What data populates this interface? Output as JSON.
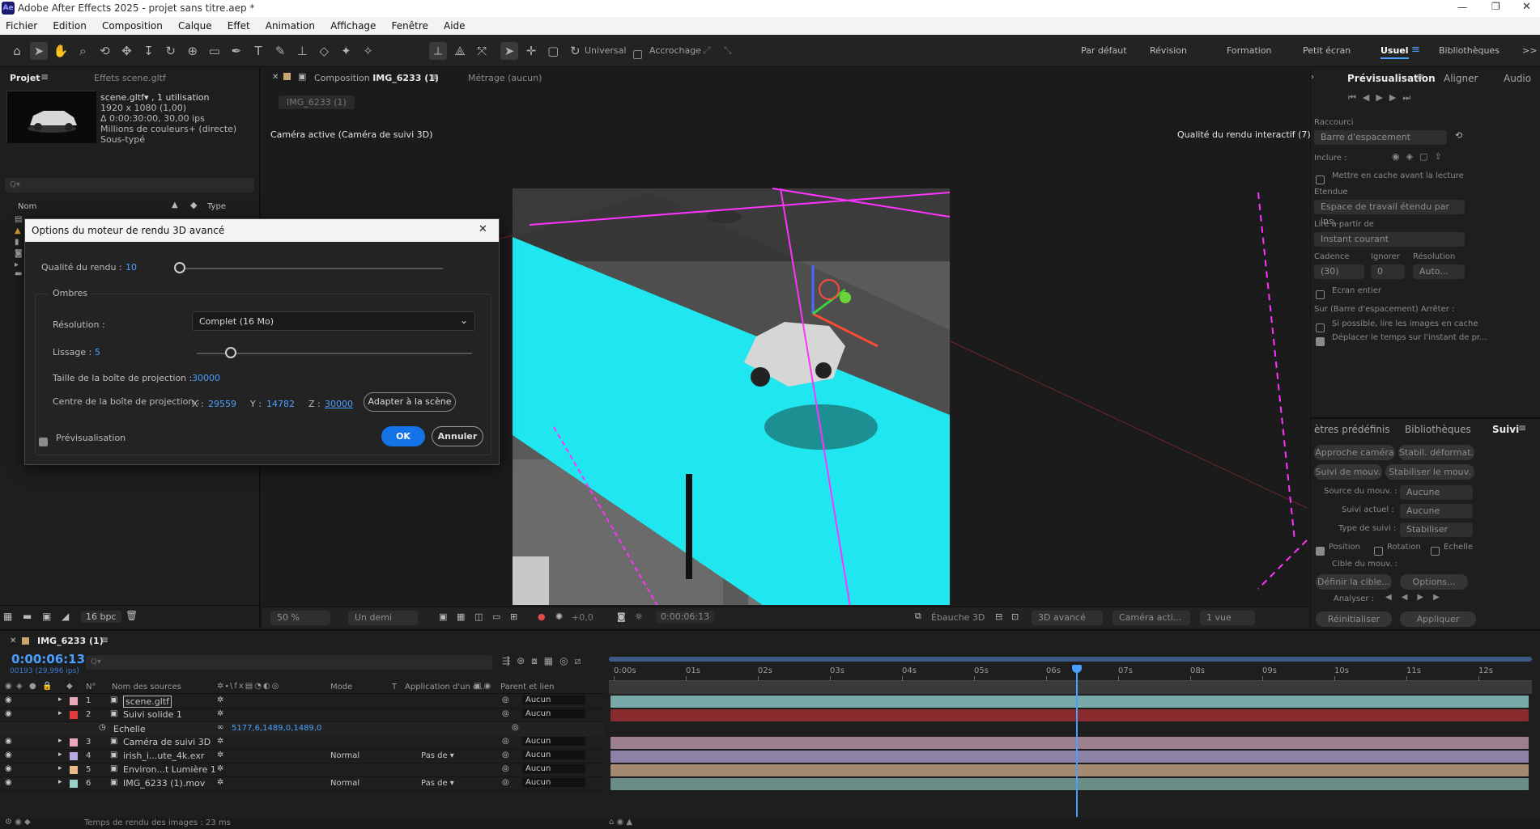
{
  "app": {
    "title": "Adobe After Effects 2025 - projet sans titre.aep *",
    "logo_text": "Ae",
    "accent": "#4aa0ff",
    "brand": "#1a1a6e"
  },
  "menu": [
    "Fichier",
    "Edition",
    "Composition",
    "Calque",
    "Effet",
    "Animation",
    "Affichage",
    "Fenêtre",
    "Aide"
  ],
  "toolbar": {
    "universal": "Universal",
    "snap": "Accrochage",
    "workspaces": [
      "Par défaut",
      "Révision",
      "Formation",
      "Petit écran",
      "Usuel",
      "Bibliothèques"
    ],
    "active_workspace": "Usuel",
    "more": ">>"
  },
  "project": {
    "tab": "Projet",
    "effects_tab": "Effets scene.gltf",
    "file_name": "scene.gltf▾ , 1 utilisation",
    "dims": "1920 x 1080 (1,00)",
    "duration": "Δ 0:00:30:00, 30,00 ips",
    "colors": "Millions de couleurs+ (directe)",
    "sub": "Sous-typé",
    "search_placeholder": "Q▾",
    "col_name": "Nom",
    "col_type": "Type",
    "bpc": "16 bpc"
  },
  "composition": {
    "tab": "Composition",
    "tab_name": "IMG_6233 (1)",
    "footage_tab": "Métrage (aucun)",
    "breadcrumb": "IMG_6233 (1)",
    "camera_label": "Caméra active (Caméra de suivi 3D)",
    "quality_label": "Qualité du rendu interactif (7)",
    "footer": {
      "zoom": "50 %",
      "resolution": "Un demi",
      "exposure": "+0,0",
      "time": "0:00:06:13",
      "draft": "Ébauche 3D",
      "renderer": "3D avancé",
      "camera": "Caméra acti...",
      "views": "1 vue"
    }
  },
  "dialog": {
    "title": "Options du moteur de rendu 3D avancé",
    "quality_label": "Qualité du rendu :",
    "quality_value": "10",
    "shadows_label": "Ombres",
    "resolution_label": "Résolution :",
    "resolution_value": "Complet (16 Mo)",
    "smoothing_label": "Lissage :",
    "smoothing_value": "5",
    "box_size_label": "Taille de la boîte de projection :",
    "box_size_value": "30000",
    "box_center_label": "Centre de la boîte de projection :",
    "x_label": "X :",
    "x_value": "29559",
    "y_label": "Y :",
    "y_value": "14782",
    "z_label": "Z :",
    "z_value": "30000",
    "fit_button": "Adapter à la scène",
    "preview_label": "Prévisualisation",
    "ok": "OK",
    "cancel": "Annuler",
    "close": "✕"
  },
  "preview_panel": {
    "tabs": [
      "Prévisualisation",
      "Aligner",
      "Audio"
    ],
    "shortcut_label": "Raccourci",
    "shortcut_value": "Barre d'espacement",
    "include_label": "Inclure :",
    "cache_label": "Mettre en cache avant la lecture",
    "range_label": "Etendue",
    "range_value": "Espace de travail étendu par ins...",
    "play_from_label": "Lire à partir de",
    "play_from_value": "Instant courant",
    "frame_rate_label": "Cadence",
    "skip_label": "Ignorer",
    "resolution_label": "Résolution",
    "frame_rate_value": "(30)",
    "skip_value": "0",
    "resolution_value": "Auto...",
    "fullscreen_label": "Ecran entier",
    "on_stop_label": "Sur (Barre d'espacement) Arrêter :",
    "option1": "Si possible, lire les images en cache",
    "option2": "Déplacer le temps sur l'instant de pr..."
  },
  "tracker_panel": {
    "tabs": [
      "ètres prédéfinis",
      "Bibliothèques",
      "Suivi"
    ],
    "buttons": [
      "Approche caméra",
      "Stabil. déformat.",
      "Suivi de mouv.",
      "Stabiliser le mouv."
    ],
    "source_label": "Source du mouv. :",
    "source_value": "Aucune",
    "current_label": "Suivi actuel :",
    "current_value": "Aucune",
    "type_label": "Type de suivi :",
    "type_value": "Stabiliser",
    "position": "Position",
    "rotation": "Rotation",
    "scale": "Echelle",
    "target_label": "Cible du mouv. :",
    "define_target": "Définir la cible...",
    "options": "Options...",
    "analyze_label": "Analyser :",
    "reset": "Réinitialiser",
    "apply": "Appliquer"
  },
  "timeline": {
    "tab": "IMG_6233 (1)",
    "timecode": "0:00:06:13",
    "frame_info": "00193 (29,996 ips)",
    "search_placeholder": "Q▾",
    "col_no": "N°",
    "col_source": "Nom des sources",
    "col_mode": "Mode",
    "col_t": "T",
    "col_track": "Application d'un c...",
    "col_parent": "Parent et lien",
    "ticks": [
      "0:00s",
      "01s",
      "02s",
      "03s",
      "04s",
      "05s",
      "06s",
      "07s",
      "08s",
      "09s",
      "10s",
      "11s",
      "12s"
    ],
    "playhead_fraction": 0.506,
    "layers": [
      {
        "num": "1",
        "name": "scene.gltf",
        "color": "#e8a9bb",
        "mode": "",
        "track": "",
        "parent": "Aucun",
        "bar": "#7aa9a9",
        "selected": true
      },
      {
        "num": "2",
        "name": "Suivi solide 1",
        "color": "#e03c3c",
        "mode": "",
        "track": "",
        "parent": "Aucun",
        "bar": "#8a2b2f",
        "selected": false
      },
      {
        "num": "3",
        "name": "Caméra de suivi 3D",
        "color": "#e8a9bb",
        "mode": "",
        "track": "",
        "parent": "Aucun",
        "bar": "#9c7f8c",
        "selected": false
      },
      {
        "num": "4",
        "name": "irish_i...ute_4k.exr",
        "color": "#b8a9e0",
        "mode": "Normal",
        "track": "Pas de ▾",
        "parent": "Aucun",
        "bar": "#8d82a6",
        "selected": false
      },
      {
        "num": "5",
        "name": "Environ...t Lumière 1",
        "color": "#e8b88a",
        "mode": "",
        "track": "",
        "parent": "Aucun",
        "bar": "#a38a70",
        "selected": false
      },
      {
        "num": "6",
        "name": "IMG_6233 (1).mov",
        "color": "#9ad0c8",
        "mode": "Normal",
        "track": "Pas de ▾",
        "parent": "Aucun",
        "bar": "#6b8d88",
        "selected": false
      }
    ],
    "scale_label": "Echelle",
    "scale_value": "5177,6,1489,0,1489,0"
  },
  "status": {
    "render_time": "Temps de rendu des images : 23 ms"
  }
}
